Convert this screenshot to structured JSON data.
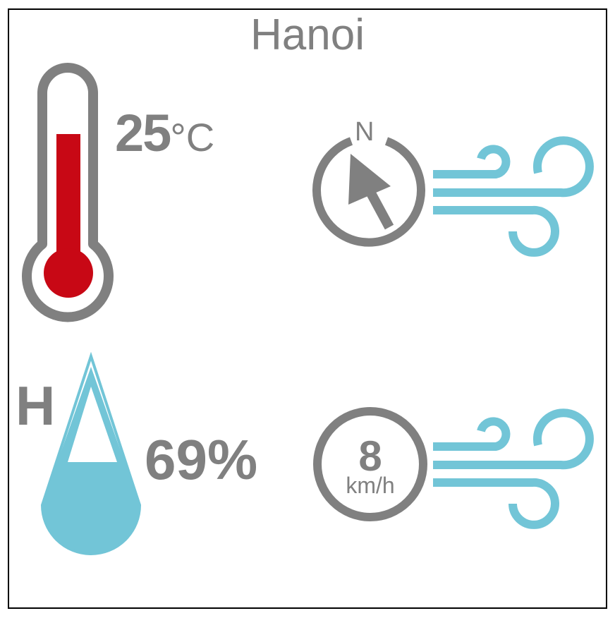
{
  "city": "Hanoi",
  "temperature": {
    "value": "25",
    "unit": "°C"
  },
  "humidity": {
    "label": "H",
    "value": "69%",
    "level": 0.69
  },
  "wind": {
    "direction_label": "N",
    "speed": "8",
    "speed_unit": "km/h"
  },
  "icons": [
    "thermometer-icon",
    "compass-icon",
    "wind-icon",
    "water-drop-icon",
    "speed-dial-icon"
  ],
  "colors": {
    "text": "#808080",
    "mercury": "#c80815",
    "water": "#72c5d7",
    "wind": "#72c5d7"
  }
}
